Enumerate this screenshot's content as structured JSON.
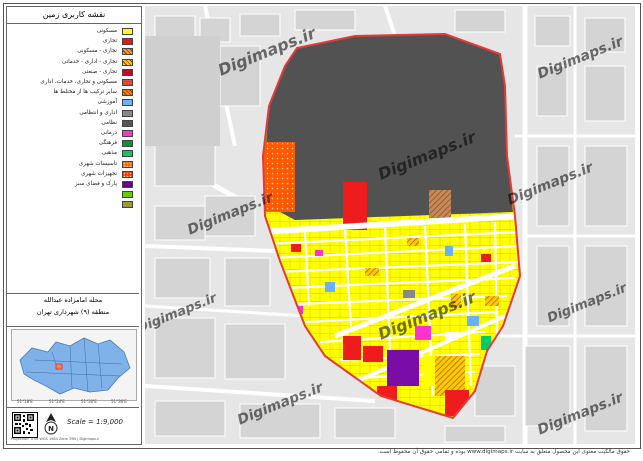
{
  "legend": {
    "title": "نقشه کاربری زمین",
    "items": [
      {
        "label": "مسکونی",
        "color": "#ffff00",
        "pattern": "solid"
      },
      {
        "label": "تجاری",
        "color": "#e3191c",
        "pattern": "solid"
      },
      {
        "label": "تجاری - مسکونی",
        "color": "#ff9933",
        "pattern": "hatch"
      },
      {
        "label": "تجاری - اداری - خدماتی",
        "color": "#ffcc00",
        "pattern": "hatch"
      },
      {
        "label": "تجاری - صنعتی",
        "color": "#cc0033",
        "pattern": "solid"
      },
      {
        "label": "مسکونی و تجاری، خدمات، اداری",
        "color": "#d94c3d",
        "pattern": "solid"
      },
      {
        "label": "سایر ترکیب ها از مختلط ها",
        "color": "#ff8000",
        "pattern": "hatch"
      },
      {
        "label": "آموزشی",
        "color": "#66b2ff",
        "pattern": "solid"
      },
      {
        "label": "اداری و انتظامی",
        "color": "#888888",
        "pattern": "solid"
      },
      {
        "label": "نظامی",
        "color": "#555555",
        "pattern": "solid"
      },
      {
        "label": "درمانی",
        "color": "#ff33cc",
        "pattern": "solid"
      },
      {
        "label": "فرهنگی",
        "color": "#009933",
        "pattern": "solid"
      },
      {
        "label": "مذهبی",
        "color": "#00cc66",
        "pattern": "solid"
      },
      {
        "label": "تاسیسات شهری",
        "color": "#ff6600",
        "pattern": "dots"
      },
      {
        "label": "تجهیزات شهری",
        "color": "#ff3300",
        "pattern": "dots"
      },
      {
        "label": "پارک و فضای سبز",
        "color": "#660099",
        "pattern": "solid"
      },
      {
        "label": "",
        "color": "#66cc00",
        "pattern": "solid"
      },
      {
        "label": "",
        "color": "#99993a",
        "pattern": "solid"
      }
    ],
    "district_line1": "محله امامزاده عبدالله",
    "district_line2": "منطقه (۹) شهرداری تهران",
    "scale": "Scale = 1:9,000",
    "foot": "Projection: UTM WGS 1984 Zone 39N | Digimaps.ir",
    "inset_ticks": [
      "51°18'E",
      "51°24'E",
      "51°30'E",
      "51°36'E"
    ]
  },
  "watermark": "Digimaps.ir",
  "footer": "حقوق مالکیت معنوی این محصول متعلق به سایت www.digimaps.ir بوده و تمامی حقوق آن محفوظ است.",
  "colors": {
    "residential": "#ffff00",
    "commercial": "#ee1c1c",
    "military": "#525252",
    "boundary": "#e33b3b",
    "facility": "#ff6a00",
    "park": "#7a0ca8",
    "road": "#ffffff"
  }
}
